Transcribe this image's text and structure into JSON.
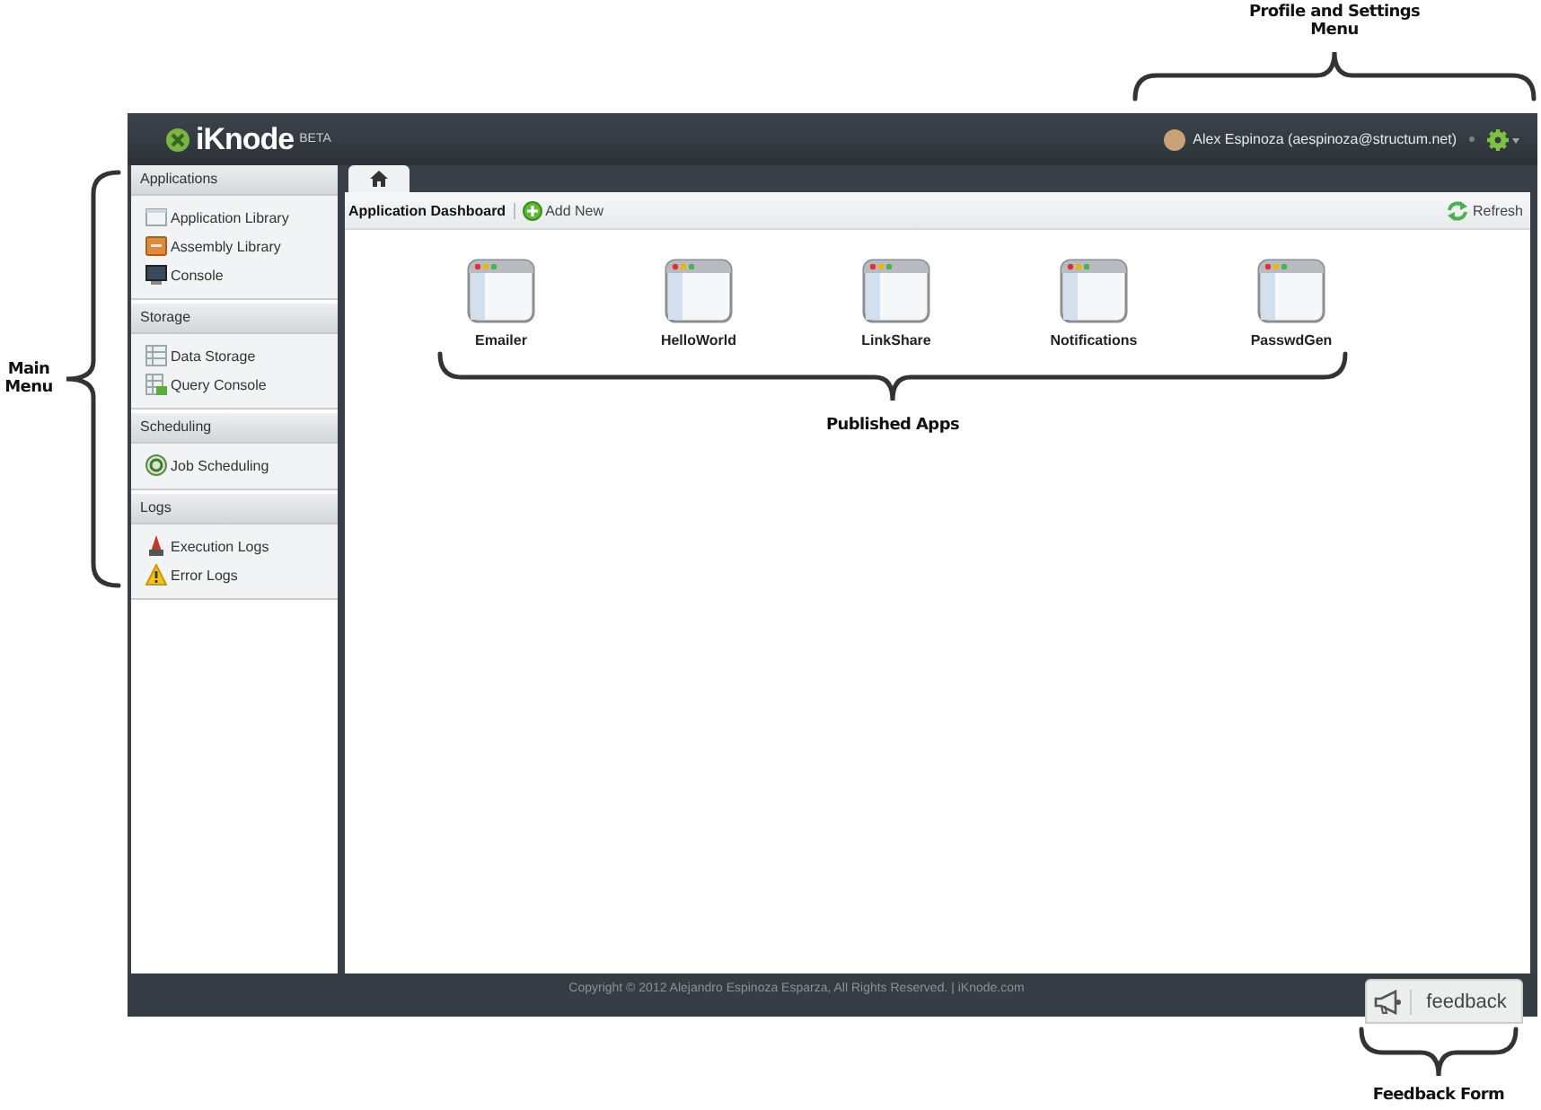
{
  "header": {
    "logo": "iKnode",
    "logo_badge": "BETA",
    "user": "Alex Espinoza (aespinoza@structum.net)"
  },
  "sidebar": {
    "sections": [
      {
        "title": "Applications",
        "items": [
          "Application Library",
          "Assembly Library",
          "Console"
        ]
      },
      {
        "title": "Storage",
        "items": [
          "Data Storage",
          "Query Console"
        ]
      },
      {
        "title": "Scheduling",
        "items": [
          "Job Scheduling"
        ]
      },
      {
        "title": "Logs",
        "items": [
          "Execution Logs",
          "Error Logs"
        ]
      }
    ]
  },
  "tabs": [
    {
      "kind": "home",
      "selected": true
    }
  ],
  "toolbar": {
    "title": "Application Dashboard",
    "add": "Add New",
    "refresh": "Refresh"
  },
  "apps": [
    "Emailer",
    "HelloWorld",
    "LinkShare",
    "Notifications",
    "PasswdGen"
  ],
  "footer": {
    "copyright": "Copyright © 2012 Alejandro Espinoza Esparza, All Rights Reserved. | iKnode.com",
    "feedback": "feedback"
  },
  "annotations": [
    {
      "kind": "brace_up",
      "label": "Profile and Settings Menu"
    },
    {
      "kind": "brace_left",
      "label": "Main Menu"
    },
    {
      "kind": "brace_down",
      "label": "Published Apps"
    },
    {
      "kind": "brace_down",
      "label": "Feedback Form"
    }
  ]
}
